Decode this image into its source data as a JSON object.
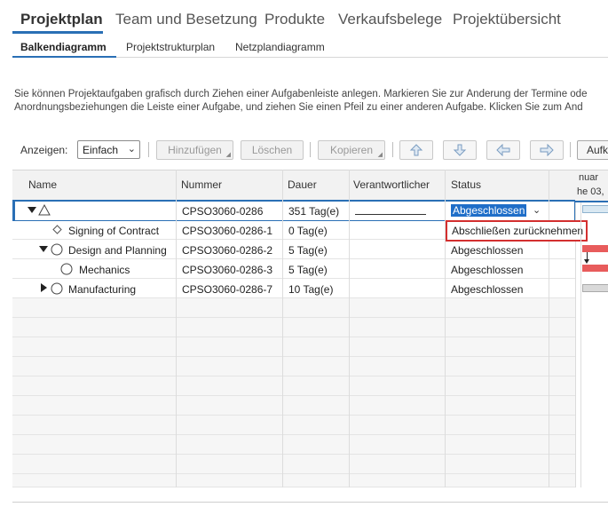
{
  "main_tabs": [
    "Projektplan",
    "Team und Besetzung",
    "Produkte",
    "Verkaufsbelege",
    "Projektübersicht"
  ],
  "sub_tabs": [
    "Balkendiagramm",
    "Projektstrukturplan",
    "Netzplandiagramm"
  ],
  "description": {
    "line1": "Sie können Projektaufgaben grafisch durch Ziehen einer Aufgabenleiste anlegen. Markieren Sie zur Änderung der Termine ode",
    "line2": "Anordnungsbeziehungen die Leiste einer Aufgabe, und ziehen Sie einen Pfeil zu einer anderen Aufgabe. Klicken Sie zum Änd"
  },
  "toolbar": {
    "show_label": "Anzeigen:",
    "view_value": "Einfach",
    "add": "Hinzufügen",
    "delete": "Löschen",
    "copy": "Kopieren",
    "truncated": "Aufk"
  },
  "table": {
    "headers": [
      "Name",
      "Nummer",
      "Dauer",
      "Verantwortlicher",
      "Status"
    ],
    "rows": [
      {
        "name": "",
        "number": "CPSO3060-0286",
        "duration": "351 Tag(e)",
        "responsible": "",
        "status": "Abgeschlossen"
      },
      {
        "name": "Signing of Contract",
        "number": "CPSO3060-0286-1",
        "duration": "0 Tag(e)",
        "responsible": "",
        "status": ""
      },
      {
        "name": "Design and Planning",
        "number": "CPSO3060-0286-2",
        "duration": "5 Tag(e)",
        "responsible": "",
        "status": "Abgeschlossen"
      },
      {
        "name": "Mechanics",
        "number": "CPSO3060-0286-3",
        "duration": "5 Tag(e)",
        "responsible": "",
        "status": "Abgeschlossen"
      },
      {
        "name": "Manufacturing",
        "number": "CPSO3060-0286-7",
        "duration": "10 Tag(e)",
        "responsible": "",
        "status": "Abgeschlossen"
      }
    ]
  },
  "status_dropdown_option": "Abschließen zurücknehmen",
  "gantt": {
    "header1": "nuar",
    "header2": "he 03,"
  },
  "colors": {
    "accent": "#2a6fb5",
    "selection": "#1f6ec8",
    "highlight_border": "#d32f2f",
    "gantt_bar_red": "#e85c5c"
  }
}
